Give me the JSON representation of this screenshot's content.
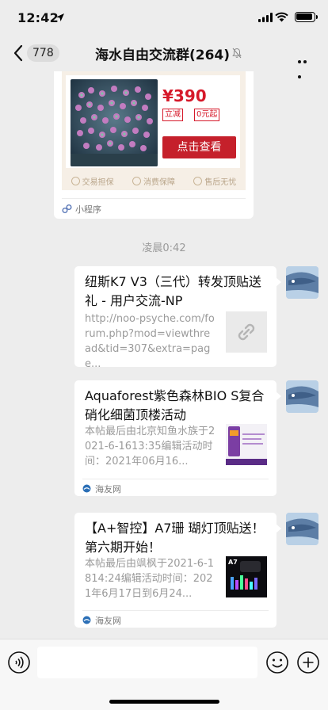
{
  "status_bar": {
    "time": "12:42"
  },
  "nav": {
    "unread_count": "778",
    "title": "海水自由交流群(264)"
  },
  "mini_program_card": {
    "price": "¥390",
    "tags": [
      "立减",
      "0元起"
    ],
    "button_label": "点击查看",
    "guarantees": [
      "交易担保",
      "消费保障",
      "售后无忧"
    ],
    "footer_label": "小程序"
  },
  "timestamp": "凌晨0:42",
  "messages": [
    {
      "title": "纽斯K7 V3（三代）转发顶贴送礼 - 用户交流-NP",
      "desc": "http://noo-psyche.com/forum.php?mod=viewthread&tid=307&extra=page..."
    },
    {
      "title": "Aquaforest紫色森林BIO S复合硝化细菌顶楼活动",
      "desc": "本帖最后由北京知鱼水族于2021-6-1613:35编辑活动时间：2021年06月16...",
      "source": "海友网"
    },
    {
      "title": "【A+智控】A7珊 瑚灯顶贴送！第六期开始！",
      "desc": "本帖最后由飒枫于2021-6-1814:24编辑活动时间：2021年6月17日到6月24...",
      "source": "海友网"
    }
  ],
  "colors": {
    "accent_red": "#d6192a",
    "chat_bg": "#ededed",
    "bubble": "#ffffff"
  },
  "icons": [
    "location-arrow-icon",
    "signal-icon",
    "wifi-icon",
    "battery-icon",
    "back-chevron-icon",
    "mute-bell-icon",
    "more-icon",
    "voice-icon",
    "emoji-icon",
    "plus-icon",
    "link-icon"
  ]
}
